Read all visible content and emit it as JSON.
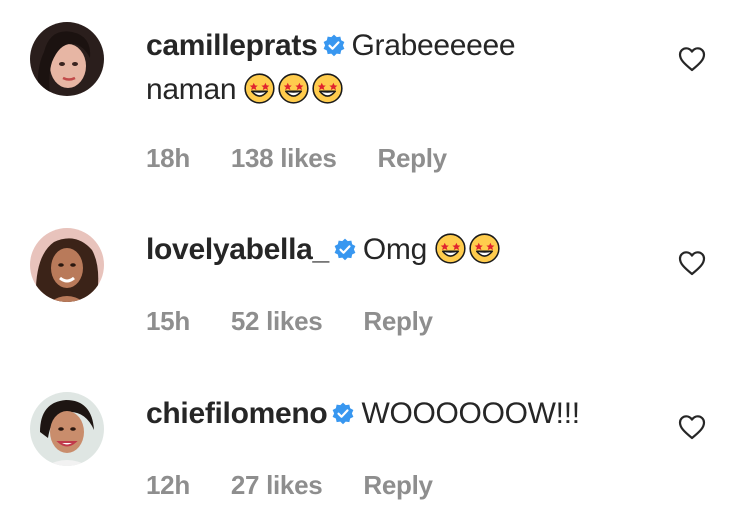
{
  "comments": [
    {
      "username": "camilleprats",
      "text": "Grabeeeeee naman",
      "text_line1": "Grabeeeeee",
      "text_line2": "naman",
      "emoji_count": 3,
      "time": "18h",
      "likes": "138 likes",
      "reply": "Reply"
    },
    {
      "username": "lovelyabella_",
      "text": "Omg",
      "emoji_count": 2,
      "time": "15h",
      "likes": "52 likes",
      "reply": "Reply"
    },
    {
      "username": "chiefilomeno",
      "text": "WOOOOOOW!!!",
      "emoji_count": 0,
      "time": "12h",
      "likes": "27 likes",
      "reply": "Reply"
    }
  ],
  "icons": {
    "verified": "verified-badge-icon",
    "heart": "heart-outline-icon",
    "emoji": "star-struck-emoji-icon"
  },
  "colors": {
    "verified": "#3897f0",
    "meta_text": "#8e8e8e",
    "primary_text": "#262626"
  }
}
